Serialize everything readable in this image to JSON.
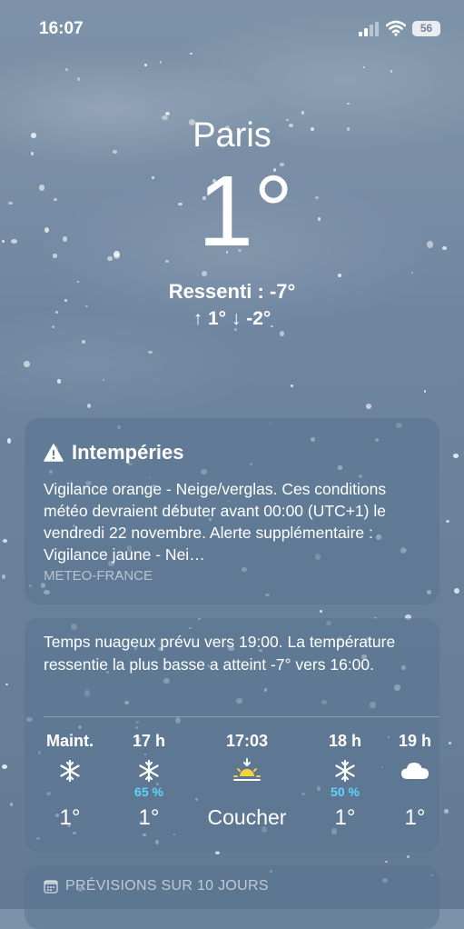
{
  "status_bar": {
    "time": "16:07",
    "battery": "56",
    "icons": [
      "cellular-signal-icon",
      "wifi-icon",
      "battery-icon"
    ]
  },
  "current": {
    "city": "Paris",
    "temperature": "1°",
    "feels_like": "Ressenti : -7°",
    "high_low": "↑ 1°  ↓ -2°"
  },
  "alert": {
    "title": "Intempéries",
    "icon": "warning-icon",
    "text": "Vigilance orange - Neige/verglas. Ces conditions météo devraient débuter avant 00:00 (UTC+1) le vendredi 22 novembre. Alerte supplémentaire : Vigilance jaune - Nei…",
    "source": "METEO-FRANCE"
  },
  "hourly": {
    "summary": "Temps nuageux prévu vers 19:00. La température ressentie la plus basse a atteint -7° vers 16:00.",
    "items": [
      {
        "hour": "Maint.",
        "icon": "snowflake-icon",
        "precip": "",
        "temp": "1°"
      },
      {
        "hour": "17 h",
        "icon": "snowflake-icon",
        "precip": "65 %",
        "temp": "1°"
      },
      {
        "hour": "17:03",
        "icon": "sunset-icon",
        "precip": "",
        "temp": "Coucher"
      },
      {
        "hour": "18 h",
        "icon": "snowflake-icon",
        "precip": "50 %",
        "temp": "1°"
      },
      {
        "hour": "19 h",
        "icon": "cloud-icon",
        "precip": "",
        "temp": "1°"
      }
    ]
  },
  "forecast": {
    "title": "PRÉVISIONS SUR 10 JOURS",
    "icon": "calendar-icon"
  },
  "colors": {
    "precip_accent": "#5ed3ff",
    "sunset_yellow": "#f6d23c"
  }
}
